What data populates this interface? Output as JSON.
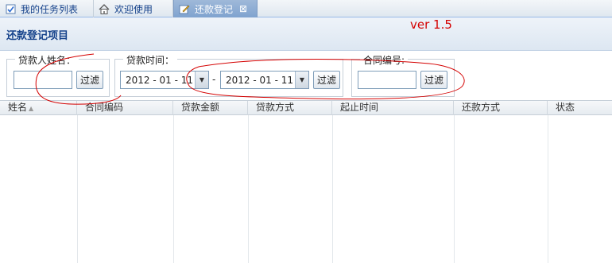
{
  "tabs": [
    {
      "label": "我的任务列表",
      "icon": "check-list-icon"
    },
    {
      "label": "欢迎使用",
      "icon": "home-icon"
    },
    {
      "label": "还款登记",
      "icon": "edit-icon",
      "close": "⊠"
    }
  ],
  "panel": {
    "title": "还款登记项目",
    "version": "ver 1.5"
  },
  "filters": {
    "borrower": {
      "legend": "贷款人姓名：",
      "value": "",
      "button": "过滤"
    },
    "loan_time": {
      "legend": "贷款时间：",
      "from": "2012 - 01 - 11",
      "separator": "-",
      "to": "2012 - 01 - 11",
      "button": "过滤"
    },
    "contract": {
      "legend": "合同编号:",
      "value": "",
      "button": "过滤"
    }
  },
  "grid": {
    "columns": [
      "姓名",
      "合同编码",
      "贷款金额",
      "贷款方式",
      "起止时间",
      "还款方式",
      "状态"
    ]
  },
  "colors": {
    "accent": "#15428b",
    "annotation": "#d40000"
  }
}
